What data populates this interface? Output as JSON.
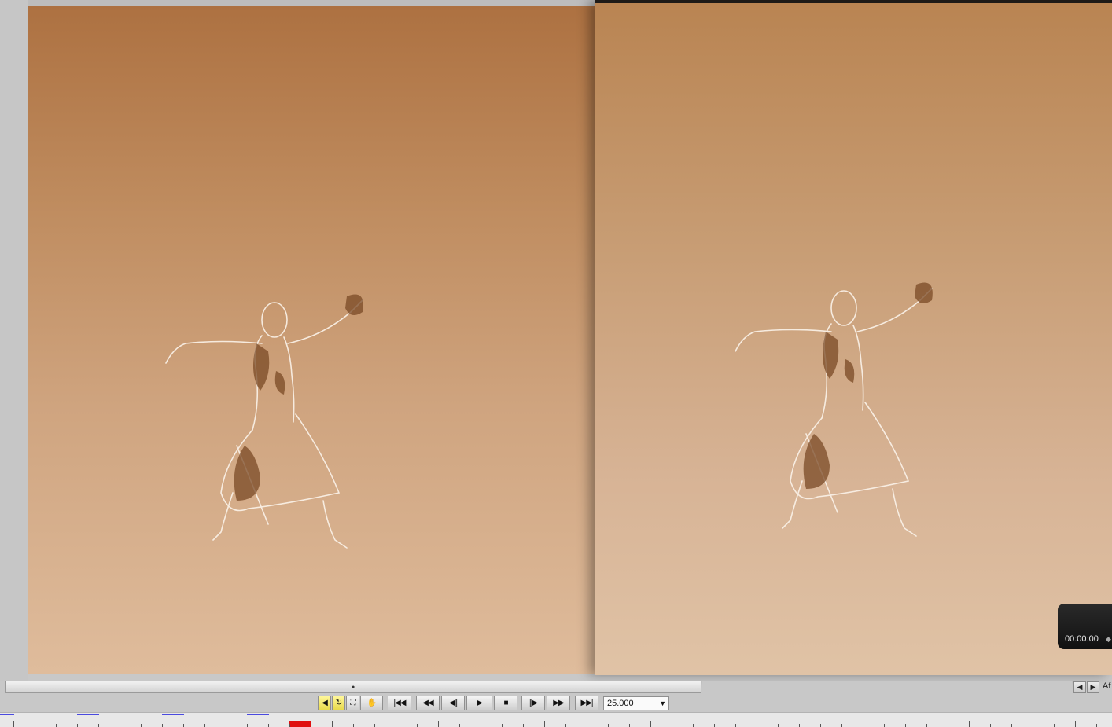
{
  "viewer": {
    "timecode": "00:00:00"
  },
  "transport": {
    "speed_value": "25.000",
    "buttons": [
      "audio",
      "loop",
      "fit",
      "pan",
      "first-frame",
      "rewind",
      "step-back",
      "play",
      "stop",
      "step-forward",
      "fast-forward",
      "last-frame"
    ]
  },
  "navigation": {
    "corner_label": "Af"
  },
  "colors": {
    "playhead": "#e01010",
    "marker": "#4a4adf",
    "toggle_active": "#f0e46a"
  },
  "icons": [
    "speaker-icon",
    "loop-icon",
    "fit-icon",
    "hand-pan-icon",
    "skip-start-icon",
    "rewind-icon",
    "step-back-icon",
    "play-icon",
    "stop-icon",
    "step-forward-icon",
    "fast-forward-icon",
    "skip-end-icon",
    "arrow-left-icon",
    "arrow-right-icon"
  ]
}
